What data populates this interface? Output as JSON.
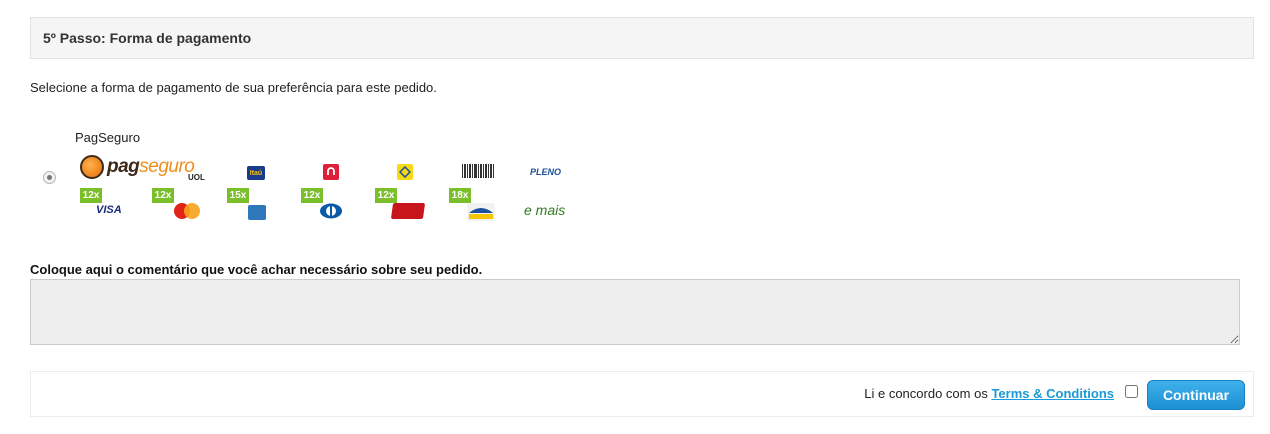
{
  "step": {
    "title": "5º Passo: Forma de pagamento"
  },
  "intro_text": "Selecione a forma de pagamento de sua preferência para este pedido.",
  "payment": {
    "method_label": "PagSeguro",
    "selected": true,
    "logo": {
      "brand_bold": "pag",
      "brand_light": "seguro",
      "sub": "UOL"
    },
    "bank_icons": [
      "itau-icon",
      "bradesco-icon",
      "banco-do-brasil-icon",
      "barcode-icon",
      "pleno-icon"
    ],
    "pleno_text": "PLENO",
    "installments": [
      {
        "badge": "12x",
        "brand": "VISA"
      },
      {
        "badge": "12x",
        "brand": "mastercard-icon"
      },
      {
        "badge": "15x",
        "brand": "amex-icon"
      },
      {
        "badge": "12x",
        "brand": "diners-icon"
      },
      {
        "badge": "12x",
        "brand": "hipercard-icon"
      },
      {
        "badge": "18x",
        "brand": "aura-icon"
      }
    ],
    "more_text": "e mais"
  },
  "comment": {
    "label": "Coloque aqui o comentário que você achar necessário sobre seu pedido.",
    "value": ""
  },
  "footer": {
    "agree_prefix": "Li e concordo com os",
    "terms_link": "Terms & Conditions",
    "agree_checked": false,
    "continue_label": "Continuar"
  },
  "colors": {
    "accent": "#1a9ad6",
    "installment_badge": "#7bbf2a",
    "pagseguro_orange": "#f08c1a"
  }
}
